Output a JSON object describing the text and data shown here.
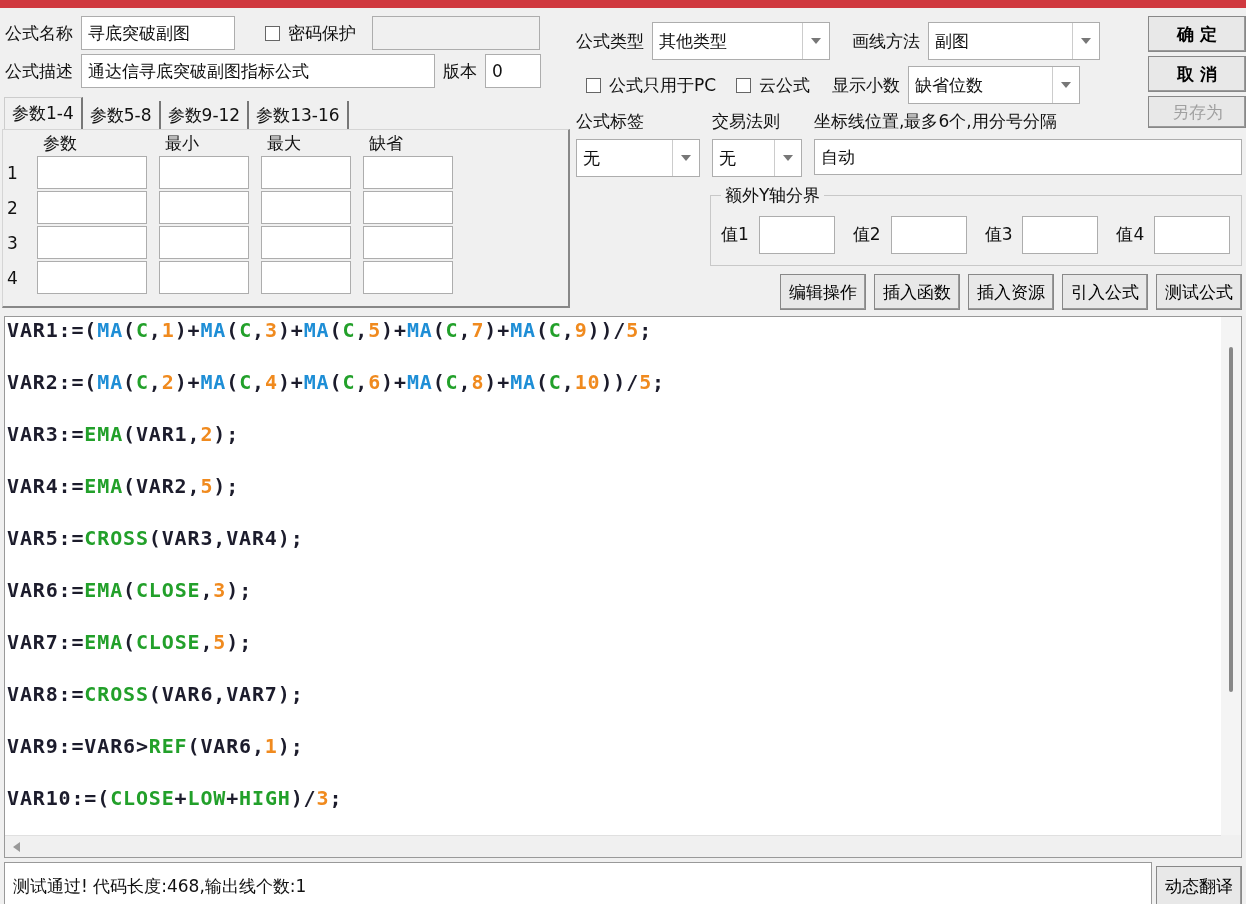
{
  "formula": {
    "name_label": "公式名称",
    "name": "寻底突破副图",
    "password": {
      "label": "密码保护",
      "checked": false
    },
    "description_label": "公式描述",
    "description": "通达信寻底突破副图指标公式",
    "version_label": "版本",
    "version": "0"
  },
  "tabs": [
    {
      "label": "参数1-4",
      "selected": true
    },
    {
      "label": "参数5-8",
      "selected": false
    },
    {
      "label": "参数9-12",
      "selected": false
    },
    {
      "label": "参数13-16",
      "selected": false
    }
  ],
  "params": {
    "columns": [
      "参数",
      "最小",
      "最大",
      "缺省"
    ],
    "rows": [
      "1",
      "2",
      "3",
      "4"
    ]
  },
  "formula_type": {
    "label": "公式类型",
    "value": "其他类型"
  },
  "draw_method": {
    "label": "画线方法",
    "value": "副图"
  },
  "pc_only": {
    "label": "公式只用于PC",
    "checked": false
  },
  "cloud": {
    "label": "云公式",
    "checked": false
  },
  "decimals": {
    "label": "显示小数",
    "value": "缺省位数"
  },
  "side_buttons": [
    {
      "label": "确 定",
      "disabled": false
    },
    {
      "label": "取 消",
      "disabled": false
    },
    {
      "label": "另存为",
      "disabled": true
    }
  ],
  "tag": {
    "label": "公式标签",
    "value": "无"
  },
  "trade_rule": {
    "label": "交易法则",
    "value": "无"
  },
  "axis_lines": {
    "label": "坐标线位置,最多6个,用分号分隔",
    "value": "自动"
  },
  "y_bounds": {
    "title": "额外Y轴分界",
    "fields": [
      {
        "label": "值1"
      },
      {
        "label": "值2"
      },
      {
        "label": "值3"
      },
      {
        "label": "值4"
      }
    ]
  },
  "tool_buttons": [
    "编辑操作",
    "插入函数",
    "插入资源",
    "引入公式",
    "测试公式"
  ],
  "code": [
    [
      {
        "text": "VAR1:=(",
        "kind": "plain"
      },
      {
        "text": "MA",
        "kind": "indicator"
      },
      {
        "text": "(",
        "kind": "plain"
      },
      {
        "text": "C",
        "kind": "function"
      },
      {
        "text": ",",
        "kind": "plain"
      },
      {
        "text": "1",
        "kind": "number"
      },
      {
        "text": ")+",
        "kind": "plain"
      },
      {
        "text": "MA",
        "kind": "indicator"
      },
      {
        "text": "(",
        "kind": "plain"
      },
      {
        "text": "C",
        "kind": "function"
      },
      {
        "text": ",",
        "kind": "plain"
      },
      {
        "text": "3",
        "kind": "number"
      },
      {
        "text": ")+",
        "kind": "plain"
      },
      {
        "text": "MA",
        "kind": "indicator"
      },
      {
        "text": "(",
        "kind": "plain"
      },
      {
        "text": "C",
        "kind": "function"
      },
      {
        "text": ",",
        "kind": "plain"
      },
      {
        "text": "5",
        "kind": "number"
      },
      {
        "text": ")+",
        "kind": "plain"
      },
      {
        "text": "MA",
        "kind": "indicator"
      },
      {
        "text": "(",
        "kind": "plain"
      },
      {
        "text": "C",
        "kind": "function"
      },
      {
        "text": ",",
        "kind": "plain"
      },
      {
        "text": "7",
        "kind": "number"
      },
      {
        "text": ")+",
        "kind": "plain"
      },
      {
        "text": "MA",
        "kind": "indicator"
      },
      {
        "text": "(",
        "kind": "plain"
      },
      {
        "text": "C",
        "kind": "function"
      },
      {
        "text": ",",
        "kind": "plain"
      },
      {
        "text": "9",
        "kind": "number"
      },
      {
        "text": "))/",
        "kind": "plain"
      },
      {
        "text": "5",
        "kind": "number"
      },
      {
        "text": ";",
        "kind": "plain"
      }
    ],
    [
      {
        "text": "VAR2:=(",
        "kind": "plain"
      },
      {
        "text": "MA",
        "kind": "indicator"
      },
      {
        "text": "(",
        "kind": "plain"
      },
      {
        "text": "C",
        "kind": "function"
      },
      {
        "text": ",",
        "kind": "plain"
      },
      {
        "text": "2",
        "kind": "number"
      },
      {
        "text": ")+",
        "kind": "plain"
      },
      {
        "text": "MA",
        "kind": "indicator"
      },
      {
        "text": "(",
        "kind": "plain"
      },
      {
        "text": "C",
        "kind": "function"
      },
      {
        "text": ",",
        "kind": "plain"
      },
      {
        "text": "4",
        "kind": "number"
      },
      {
        "text": ")+",
        "kind": "plain"
      },
      {
        "text": "MA",
        "kind": "indicator"
      },
      {
        "text": "(",
        "kind": "plain"
      },
      {
        "text": "C",
        "kind": "function"
      },
      {
        "text": ",",
        "kind": "plain"
      },
      {
        "text": "6",
        "kind": "number"
      },
      {
        "text": ")+",
        "kind": "plain"
      },
      {
        "text": "MA",
        "kind": "indicator"
      },
      {
        "text": "(",
        "kind": "plain"
      },
      {
        "text": "C",
        "kind": "function"
      },
      {
        "text": ",",
        "kind": "plain"
      },
      {
        "text": "8",
        "kind": "number"
      },
      {
        "text": ")+",
        "kind": "plain"
      },
      {
        "text": "MA",
        "kind": "indicator"
      },
      {
        "text": "(",
        "kind": "plain"
      },
      {
        "text": "C",
        "kind": "function"
      },
      {
        "text": ",",
        "kind": "plain"
      },
      {
        "text": "10",
        "kind": "number"
      },
      {
        "text": "))/",
        "kind": "plain"
      },
      {
        "text": "5",
        "kind": "number"
      },
      {
        "text": ";",
        "kind": "plain"
      }
    ],
    [
      {
        "text": "VAR3:=",
        "kind": "plain"
      },
      {
        "text": "EMA",
        "kind": "function"
      },
      {
        "text": "(VAR1,",
        "kind": "plain"
      },
      {
        "text": "2",
        "kind": "number"
      },
      {
        "text": ");",
        "kind": "plain"
      }
    ],
    [
      {
        "text": "VAR4:=",
        "kind": "plain"
      },
      {
        "text": "EMA",
        "kind": "function"
      },
      {
        "text": "(VAR2,",
        "kind": "plain"
      },
      {
        "text": "5",
        "kind": "number"
      },
      {
        "text": ");",
        "kind": "plain"
      }
    ],
    [
      {
        "text": "VAR5:=",
        "kind": "plain"
      },
      {
        "text": "CROSS",
        "kind": "function"
      },
      {
        "text": "(VAR3,VAR4);",
        "kind": "plain"
      }
    ],
    [
      {
        "text": "VAR6:=",
        "kind": "plain"
      },
      {
        "text": "EMA",
        "kind": "function"
      },
      {
        "text": "(",
        "kind": "plain"
      },
      {
        "text": "CLOSE",
        "kind": "function"
      },
      {
        "text": ",",
        "kind": "plain"
      },
      {
        "text": "3",
        "kind": "number"
      },
      {
        "text": ");",
        "kind": "plain"
      }
    ],
    [
      {
        "text": "VAR7:=",
        "kind": "plain"
      },
      {
        "text": "EMA",
        "kind": "function"
      },
      {
        "text": "(",
        "kind": "plain"
      },
      {
        "text": "CLOSE",
        "kind": "function"
      },
      {
        "text": ",",
        "kind": "plain"
      },
      {
        "text": "5",
        "kind": "number"
      },
      {
        "text": ");",
        "kind": "plain"
      }
    ],
    [
      {
        "text": "VAR8:=",
        "kind": "plain"
      },
      {
        "text": "CROSS",
        "kind": "function"
      },
      {
        "text": "(VAR6,VAR7);",
        "kind": "plain"
      }
    ],
    [
      {
        "text": "VAR9:=VAR6>",
        "kind": "plain"
      },
      {
        "text": "REF",
        "kind": "function"
      },
      {
        "text": "(VAR6,",
        "kind": "plain"
      },
      {
        "text": "1",
        "kind": "number"
      },
      {
        "text": ");",
        "kind": "plain"
      }
    ],
    [
      {
        "text": "VAR10:=(",
        "kind": "plain"
      },
      {
        "text": "CLOSE",
        "kind": "function"
      },
      {
        "text": "+",
        "kind": "plain"
      },
      {
        "text": "LOW",
        "kind": "function"
      },
      {
        "text": "+",
        "kind": "plain"
      },
      {
        "text": "HIGH",
        "kind": "function"
      },
      {
        "text": ")/",
        "kind": "plain"
      },
      {
        "text": "3",
        "kind": "number"
      },
      {
        "text": ";",
        "kind": "plain"
      }
    ]
  ],
  "status": {
    "message": "测试通过! 代码长度:468,输出线个数:1",
    "button": "动态翻译"
  }
}
